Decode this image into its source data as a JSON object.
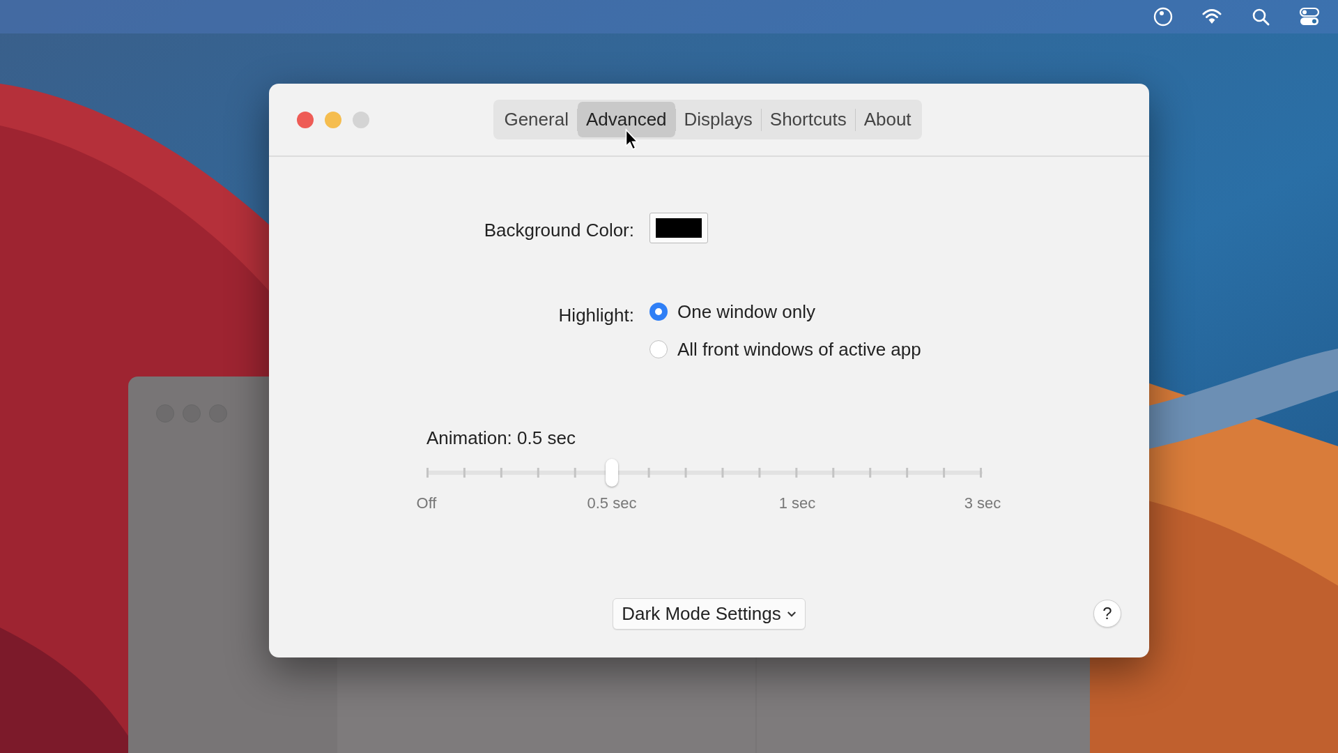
{
  "window": {
    "tabs": [
      {
        "label": "General",
        "selected": false
      },
      {
        "label": "Advanced",
        "selected": true
      },
      {
        "label": "Displays",
        "selected": false
      },
      {
        "label": "Shortcuts",
        "selected": false
      },
      {
        "label": "About",
        "selected": false
      }
    ]
  },
  "background_color": {
    "label": "Background Color:"
  },
  "highlight": {
    "label": "Highlight:",
    "options": [
      {
        "label": "One window only",
        "selected": true
      },
      {
        "label": "All front windows of active app",
        "selected": false
      }
    ]
  },
  "animation": {
    "label": "Animation: 0.5 sec",
    "level": 0.3333,
    "scale_labels": [
      "Off",
      "0.5 sec",
      "1 sec",
      "3 sec"
    ]
  },
  "dark_mode_button": {
    "label": "Dark Mode Settings"
  },
  "help_button": {
    "label": "?"
  }
}
